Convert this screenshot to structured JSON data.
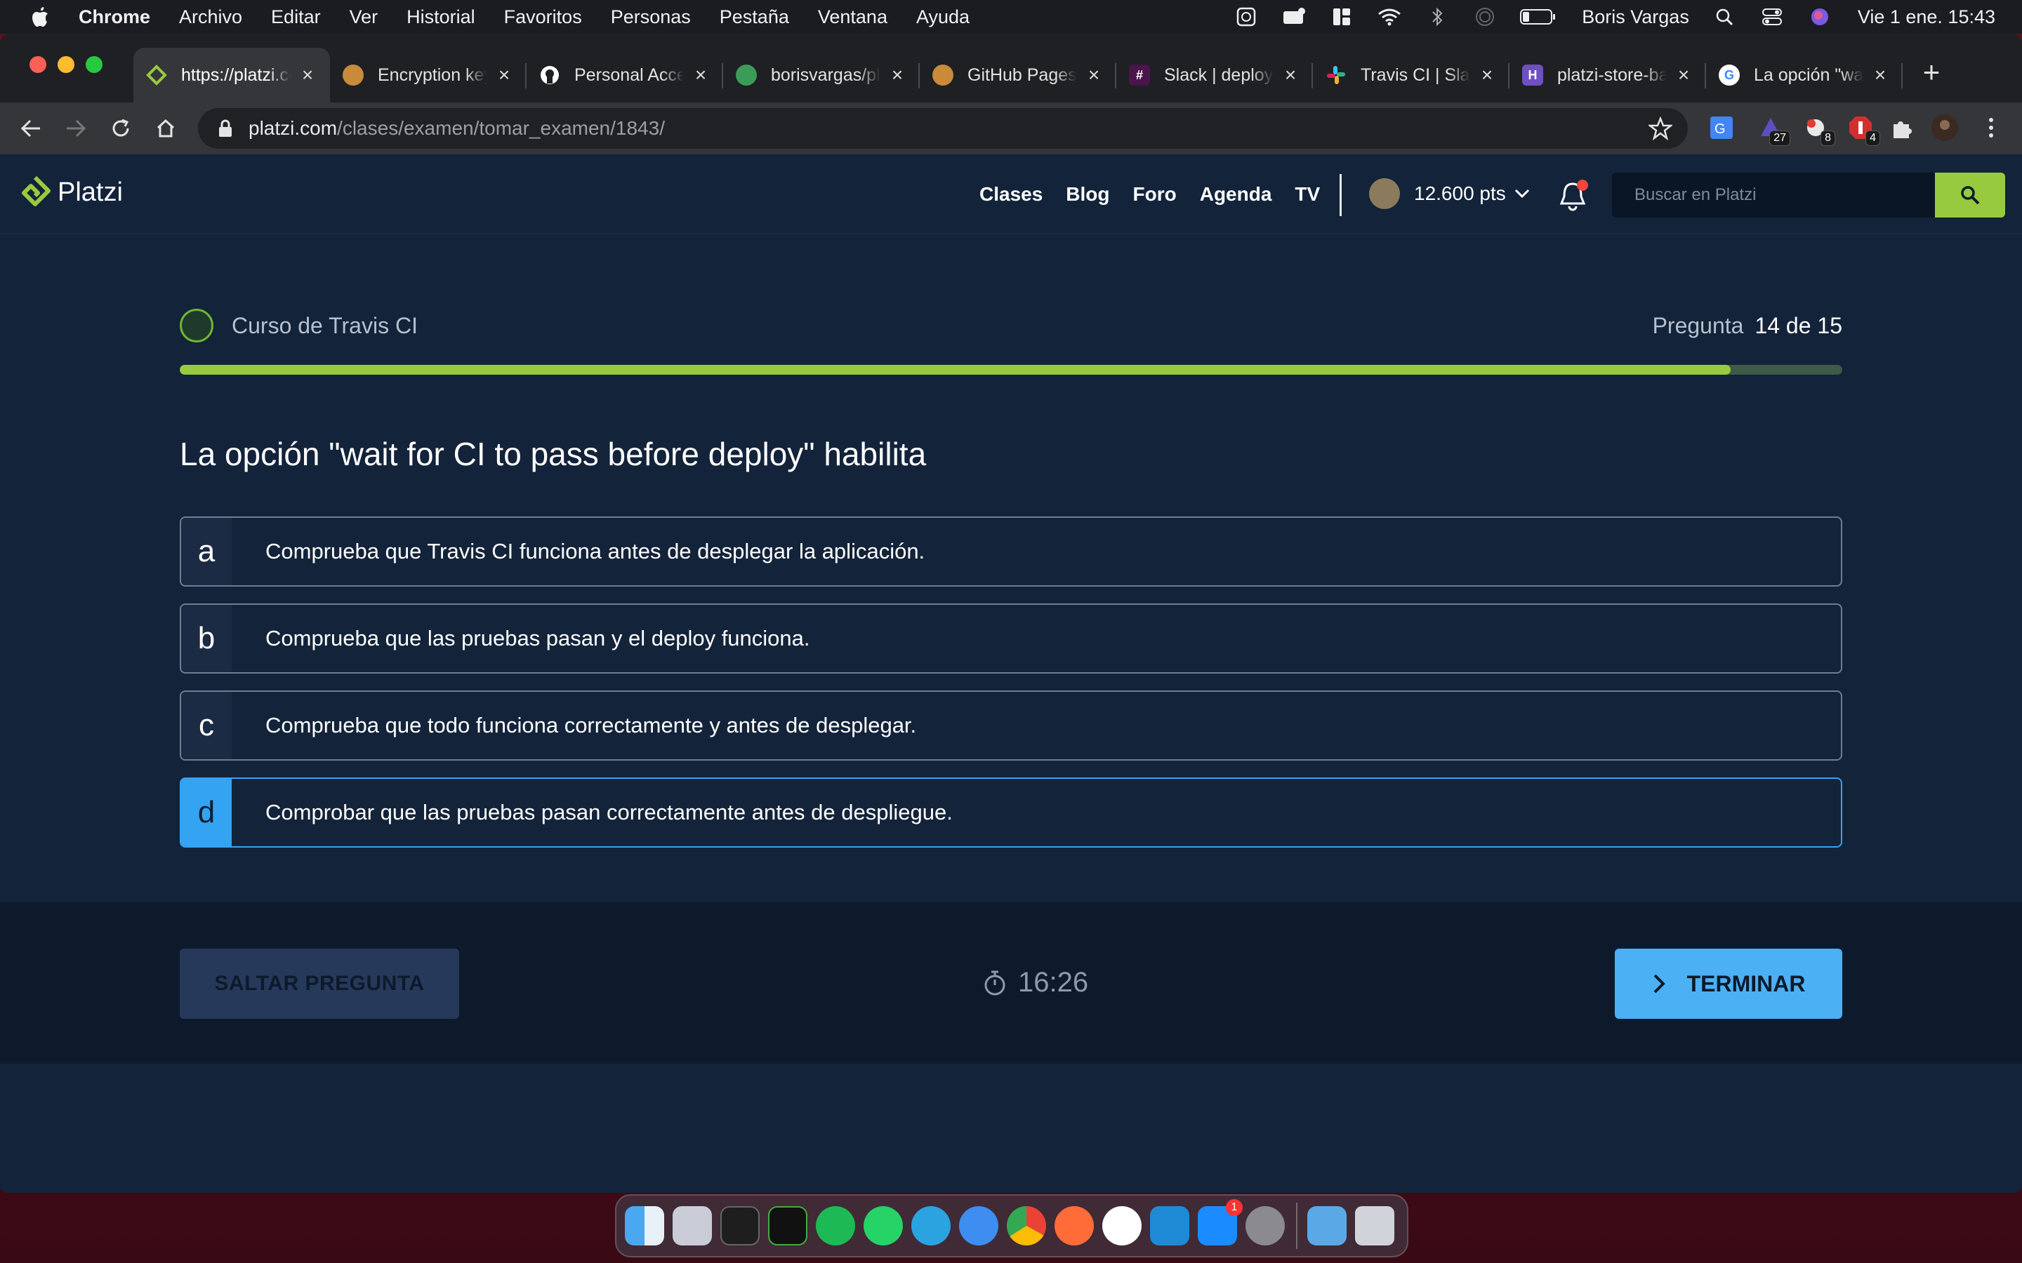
{
  "menubar": {
    "app": "Chrome",
    "items": [
      "Archivo",
      "Editar",
      "Ver",
      "Historial",
      "Favoritos",
      "Personas",
      "Pestaña",
      "Ventana",
      "Ayuda"
    ],
    "user": "Boris Vargas",
    "clock": "Vie 1 ene.  15:43"
  },
  "tabs": [
    {
      "title": "https://platzi.com/clases/examen",
      "favicon_color": "#98ca3f"
    },
    {
      "title": "Encryption keys",
      "favicon_color": "#c98a3a"
    },
    {
      "title": "Personal Access Tokens",
      "favicon_color": "#ffffff"
    },
    {
      "title": "borisvargas/platzi",
      "favicon_color": "#3c9b59"
    },
    {
      "title": "GitHub Pages",
      "favicon_color": "#c98a3a"
    },
    {
      "title": "Slack | deploy",
      "favicon_color": "#4a154b"
    },
    {
      "title": "Travis CI | Slack",
      "favicon_color": "#e01e5a"
    },
    {
      "title": "platzi-store-backend",
      "favicon_color": "#6f4fc2"
    },
    {
      "title": "La opción \"wait for CI\"",
      "favicon_color": "#ffffff"
    }
  ],
  "omnibox": {
    "host": "platzi.com",
    "path": "/clases/examen/tomar_examen/1843/"
  },
  "extensions": {
    "badge_1": "27",
    "badge_2": "8",
    "badge_3": "4"
  },
  "header": {
    "logo": "Platzi",
    "nav": [
      "Clases",
      "Blog",
      "Foro",
      "Agenda",
      "TV"
    ],
    "points": "12.600 pts",
    "search_placeholder": "Buscar en Platzi"
  },
  "exam": {
    "course": "Curso de Travis CI",
    "question_label": "Pregunta",
    "question_number": "14 de 15",
    "progress": 0.933,
    "question": "La opción \"wait for CI to pass before deploy\" habilita",
    "options": [
      {
        "letter": "a",
        "text": "Comprueba que Travis CI funciona antes de desplegar la aplicación."
      },
      {
        "letter": "b",
        "text": "Comprueba que las pruebas pasan y el deploy funciona."
      },
      {
        "letter": "c",
        "text": "Comprueba que todo funciona correctamente y antes de desplegar."
      },
      {
        "letter": "d",
        "text": "Comprobar que las pruebas pasan correctamente antes de despliegue."
      }
    ],
    "selected": "d",
    "skip_label": "SALTAR PREGUNTA",
    "timer": "16:26",
    "finish_label": "TERMINAR"
  },
  "colors": {
    "accent_green": "#98ca3f",
    "accent_blue": "#34a3f2",
    "bg_dark": "#13233a"
  },
  "dock": {
    "apps": [
      "finder-icon",
      "launchpad-icon",
      "terminal-icon",
      "iterm-icon",
      "spotify-icon",
      "whatsapp-icon",
      "telegram-icon",
      "safari-icon",
      "chrome-icon",
      "postman-icon",
      "notion-icon",
      "vscode-icon",
      "app-store-icon",
      "system-preferences-icon",
      "downloads-folder-icon",
      "trash-icon"
    ],
    "app_store_badge": "1"
  }
}
